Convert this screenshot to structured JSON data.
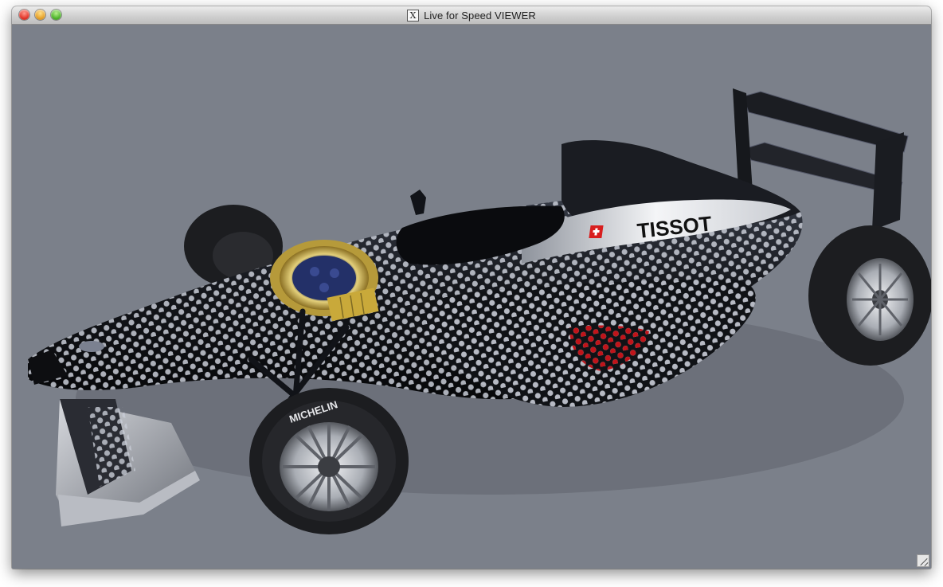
{
  "window": {
    "title": "Live for Speed VIEWER",
    "title_icon": "x11-icon",
    "controls": [
      "close-button",
      "minimize-button",
      "zoom-button"
    ]
  },
  "viewport": {
    "background_color": "#7b808a",
    "content": "formula-race-car-3d-model",
    "sponsor_text": "TISSOT",
    "tire_text": "MICHELIN",
    "car_colors": {
      "body": "#15171c",
      "dots": "#c8ccd6",
      "accent_dots": "#c0141a",
      "sidepod": "#e9ebee",
      "watch_gold": "#c9a93a"
    }
  }
}
